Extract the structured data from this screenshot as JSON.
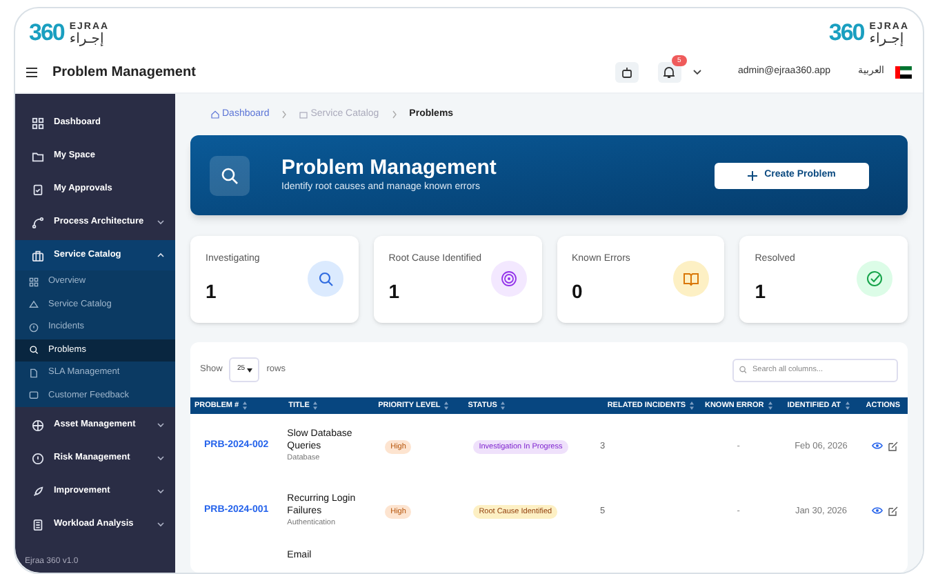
{
  "logo_left": {
    "latin": "EJRAA",
    "arabic": "إجـراء",
    "number": "360"
  },
  "logo_right": {
    "latin": "EJRAA",
    "arabic": "إجـراء",
    "number": "360"
  },
  "topbar": {
    "title": "Problem Management",
    "notifications": "5",
    "user": "admin@ejraa360.app",
    "language": "العربية"
  },
  "sidebar": {
    "items": [
      {
        "label": "Dashboard",
        "selected": false
      },
      {
        "label": "My Space",
        "selected": false
      },
      {
        "label": "My Approvals",
        "selected": false
      },
      {
        "label": "Process Architecture",
        "selected": false,
        "expanded": false
      },
      {
        "label": "Service Catalog",
        "selected": true,
        "expanded": true,
        "children": [
          {
            "label": "Overview",
            "selected": false
          },
          {
            "label": "Service Catalog",
            "selected": false
          },
          {
            "label": "Incidents",
            "selected": false
          },
          {
            "label": "Problems",
            "selected": true
          },
          {
            "label": "SLA Management",
            "selected": false
          },
          {
            "label": "Customer Feedback",
            "selected": false
          }
        ]
      },
      {
        "label": "Asset Management",
        "selected": false,
        "expanded": false
      },
      {
        "label": "Risk Management",
        "selected": false,
        "expanded": false
      },
      {
        "label": "Improvement",
        "selected": false,
        "expanded": false
      },
      {
        "label": "Workload Analysis",
        "selected": false,
        "expanded": false
      }
    ],
    "version": "Ejraa 360 v1.0"
  },
  "breadcrumb": [
    "Dashboard",
    "Service Catalog",
    "Problems"
  ],
  "banner": {
    "title": "Problem Management",
    "subtitle": "Identify root causes and manage known errors",
    "button": "Create Problem"
  },
  "stats": [
    {
      "label": "Investigating",
      "value": "1",
      "color": "#dbeafe"
    },
    {
      "label": "Root Cause Identified",
      "value": "1",
      "color": "#f3e8ff"
    },
    {
      "label": "Known Errors",
      "value": "0",
      "color": "#fdf0c4"
    },
    {
      "label": "Resolved",
      "value": "1",
      "color": "#dcfce7"
    }
  ],
  "table": {
    "show_label": "Show",
    "page_size": "25",
    "rows_label": "rows",
    "search_placeholder": "Search all columns...",
    "columns": [
      "PROBLEM #",
      "TITLE",
      "PRIORITY LEVEL",
      "STATUS",
      "RELATED INCIDENTS",
      "KNOWN ERROR",
      "IDENTIFIED AT",
      "ACTIONS"
    ],
    "rows": [
      {
        "id": "PRB-2024-002",
        "title": "Slow Database Queries",
        "category": "Database",
        "priority": "High",
        "status": {
          "label": "Investigation In Progress",
          "color": "#efe1fb"
        },
        "incidents": "3",
        "known_error": "-",
        "identified_at": "Feb 06, 2026"
      },
      {
        "id": "PRB-2024-001",
        "title": "Recurring Login Failures",
        "category": "Authentication",
        "priority": "High",
        "status": {
          "label": "Root Cause Identified",
          "color": "#fdf0c4"
        },
        "incidents": "5",
        "known_error": "-",
        "identified_at": "Jan 30, 2026"
      },
      {
        "title": "Email"
      }
    ]
  }
}
